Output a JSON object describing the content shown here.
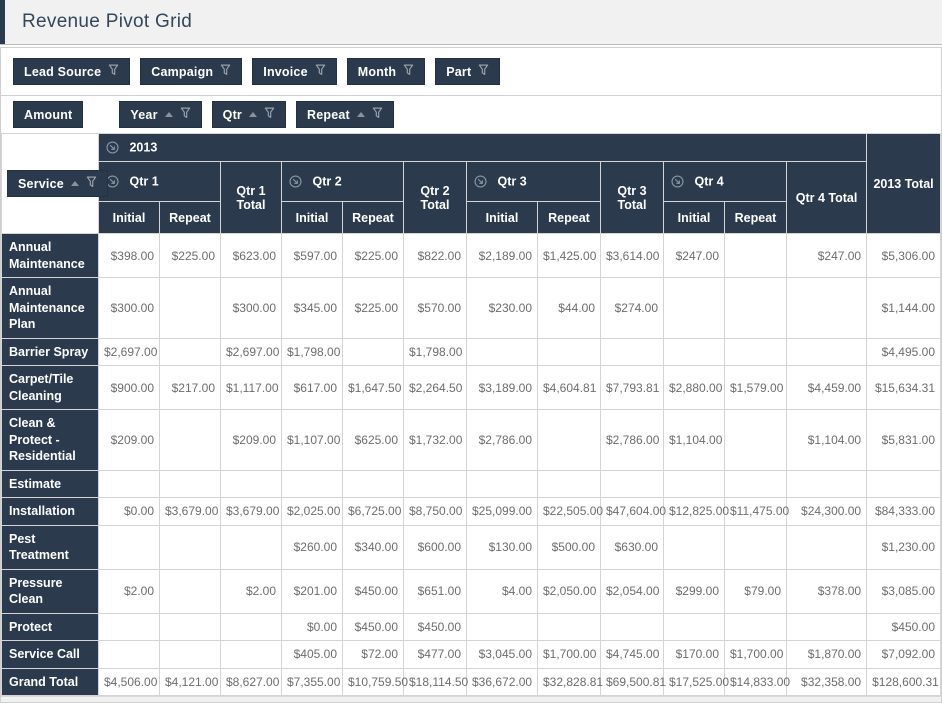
{
  "header": {
    "title": "Revenue Pivot Grid"
  },
  "filter_area": {
    "fields": [
      {
        "label": "Lead Source"
      },
      {
        "label": "Campaign"
      },
      {
        "label": "Invoice"
      },
      {
        "label": "Month"
      },
      {
        "label": "Part"
      }
    ]
  },
  "data_area": {
    "field_label": "Amount"
  },
  "column_area": {
    "fields": [
      {
        "label": "Year"
      },
      {
        "label": "Qtr"
      },
      {
        "label": "Repeat"
      }
    ]
  },
  "row_area": {
    "field_label": "Service"
  },
  "colors": {
    "accent_navy": "#2b3a4d",
    "title_text": "#33475b",
    "data_text": "#6d6d6d",
    "border": "#d4d4d4",
    "titlebar_bg": "#f1f1f1"
  },
  "pivot": {
    "year": {
      "label": "2013",
      "total_label": "2013 Total"
    },
    "quarters": [
      {
        "label": "Qtr 1",
        "total_label": "Qtr 1 Total"
      },
      {
        "label": "Qtr 2",
        "total_label": "Qtr 2 Total"
      },
      {
        "label": "Qtr 3",
        "total_label": "Qtr 3 Total"
      },
      {
        "label": "Qtr 4",
        "total_label": "Qtr 4 Total"
      }
    ],
    "sub_headers": [
      "Initial",
      "Repeat"
    ],
    "rows": [
      {
        "label": "Annual Maintenance",
        "values": [
          "$398.00",
          "$225.00",
          "$623.00",
          "$597.00",
          "$225.00",
          "$822.00",
          "$2,189.00",
          "$1,425.00",
          "$3,614.00",
          "$247.00",
          "",
          "$247.00",
          "$5,306.00"
        ]
      },
      {
        "label": "Annual Maintenance Plan",
        "values": [
          "$300.00",
          "",
          "$300.00",
          "$345.00",
          "$225.00",
          "$570.00",
          "$230.00",
          "$44.00",
          "$274.00",
          "",
          "",
          "",
          "$1,144.00"
        ]
      },
      {
        "label": "Barrier Spray",
        "values": [
          "$2,697.00",
          "",
          "$2,697.00",
          "$1,798.00",
          "",
          "$1,798.00",
          "",
          "",
          "",
          "",
          "",
          "",
          "$4,495.00"
        ]
      },
      {
        "label": "Carpet/Tile Cleaning",
        "values": [
          "$900.00",
          "$217.00",
          "$1,117.00",
          "$617.00",
          "$1,647.50",
          "$2,264.50",
          "$3,189.00",
          "$4,604.81",
          "$7,793.81",
          "$2,880.00",
          "$1,579.00",
          "$4,459.00",
          "$15,634.31"
        ]
      },
      {
        "label": "Clean & Protect - Residential",
        "values": [
          "$209.00",
          "",
          "$209.00",
          "$1,107.00",
          "$625.00",
          "$1,732.00",
          "$2,786.00",
          "",
          "$2,786.00",
          "$1,104.00",
          "",
          "$1,104.00",
          "$5,831.00"
        ]
      },
      {
        "label": "Estimate",
        "values": [
          "",
          "",
          "",
          "",
          "",
          "",
          "",
          "",
          "",
          "",
          "",
          "",
          ""
        ]
      },
      {
        "label": "Installation",
        "values": [
          "$0.00",
          "$3,679.00",
          "$3,679.00",
          "$2,025.00",
          "$6,725.00",
          "$8,750.00",
          "$25,099.00",
          "$22,505.00",
          "$47,604.00",
          "$12,825.00",
          "$11,475.00",
          "$24,300.00",
          "$84,333.00"
        ]
      },
      {
        "label": "Pest Treatment",
        "values": [
          "",
          "",
          "",
          "$260.00",
          "$340.00",
          "$600.00",
          "$130.00",
          "$500.00",
          "$630.00",
          "",
          "",
          "",
          "$1,230.00"
        ]
      },
      {
        "label": "Pressure Clean",
        "values": [
          "$2.00",
          "",
          "$2.00",
          "$201.00",
          "$450.00",
          "$651.00",
          "$4.00",
          "$2,050.00",
          "$2,054.00",
          "$299.00",
          "$79.00",
          "$378.00",
          "$3,085.00"
        ]
      },
      {
        "label": "Protect",
        "values": [
          "",
          "",
          "",
          "$0.00",
          "$450.00",
          "$450.00",
          "",
          "",
          "",
          "",
          "",
          "",
          "$450.00"
        ]
      },
      {
        "label": "Service Call",
        "values": [
          "",
          "",
          "",
          "$405.00",
          "$72.00",
          "$477.00",
          "$3,045.00",
          "$1,700.00",
          "$4,745.00",
          "$170.00",
          "$1,700.00",
          "$1,870.00",
          "$7,092.00"
        ]
      },
      {
        "label": "Grand Total",
        "is_grand": true,
        "values": [
          "$4,506.00",
          "$4,121.00",
          "$8,627.00",
          "$7,355.00",
          "$10,759.50",
          "$18,114.50",
          "$36,672.00",
          "$32,828.81",
          "$69,500.81",
          "$17,525.00",
          "$14,833.00",
          "$32,358.00",
          "$128,600.31"
        ]
      }
    ]
  }
}
